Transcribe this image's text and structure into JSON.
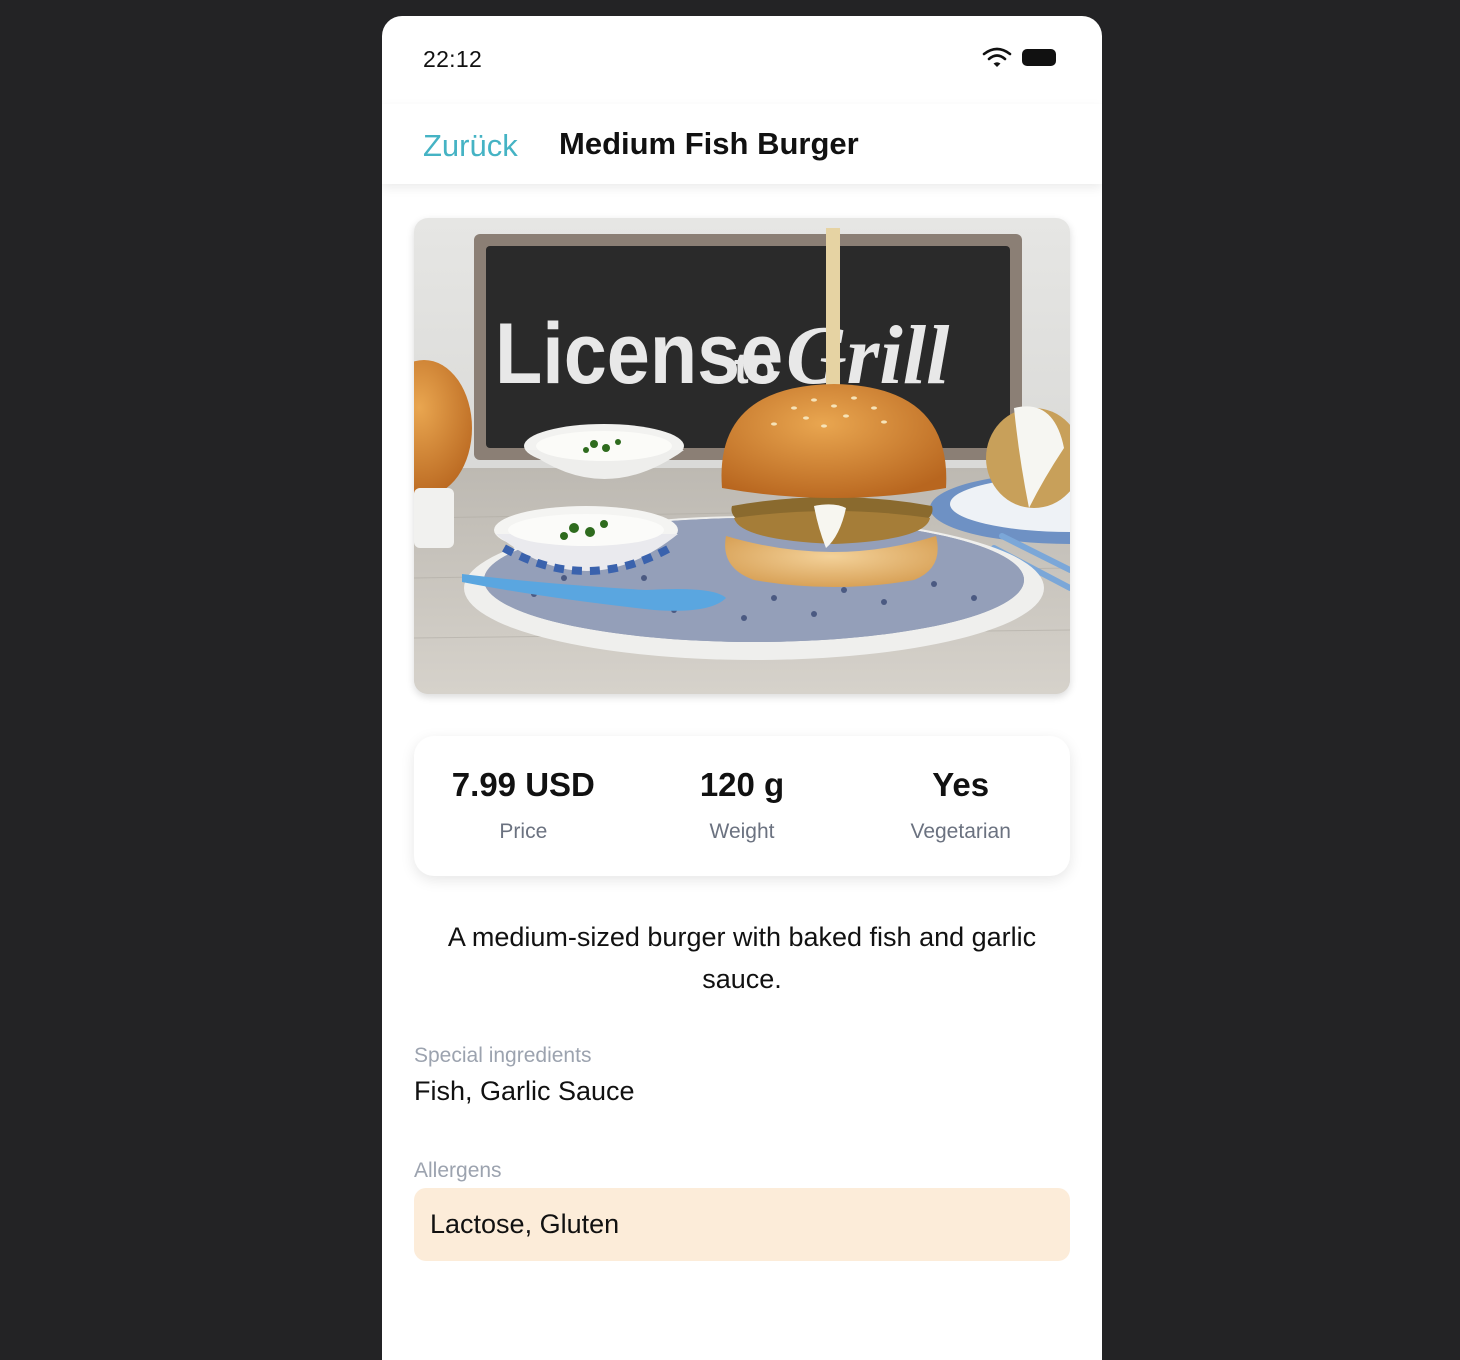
{
  "status_bar": {
    "time": "22:12",
    "icons": [
      "wifi-icon",
      "battery-icon"
    ]
  },
  "nav": {
    "back_label": "Zurück",
    "title": "Medium Fish Burger"
  },
  "photo": {
    "sign_text_main": "License",
    "sign_text_small": "to",
    "sign_text_script": "Grill"
  },
  "stats": [
    {
      "value": "7.99 USD",
      "label": "Price"
    },
    {
      "value": "120 g",
      "label": "Weight"
    },
    {
      "value": "Yes",
      "label": "Vegetarian"
    }
  ],
  "description": "A medium-sized burger with baked fish and garlic sauce.",
  "ingredients": {
    "label": "Special ingredients",
    "value": "Fish, Garlic Sauce"
  },
  "allergens": {
    "label": "Allergens",
    "value": "Lactose, Gluten"
  },
  "colors": {
    "accent": "#45b3c4",
    "allergen_bg": "#fcecd9",
    "page_bg": "#232325"
  }
}
